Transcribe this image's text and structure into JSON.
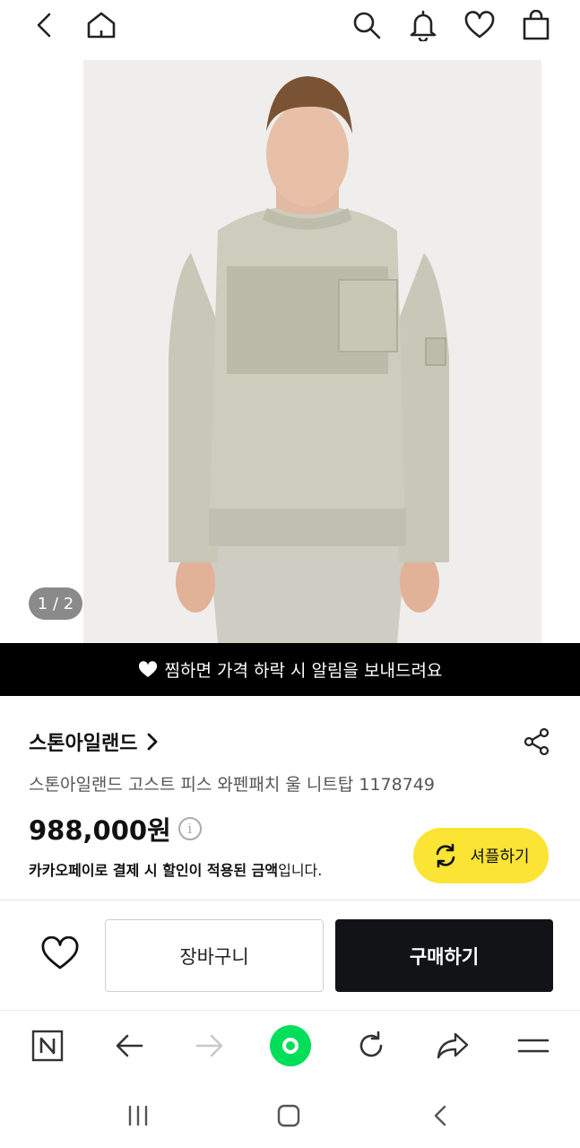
{
  "top_bar": {
    "icons": [
      "back-icon",
      "home-icon",
      "search-icon",
      "bell-icon",
      "heart-icon",
      "shopping-bag-icon"
    ]
  },
  "gallery": {
    "page_counter": "1 / 2"
  },
  "alert_banner": {
    "text": "찜하면 가격 하락 시 알림을 보내드려요"
  },
  "product": {
    "brand": "스톤아일랜드",
    "title": "스톤아일랜드 고스트 피스 와펜패치 울 니트탑 1178749",
    "price": "988,000원",
    "kakao_note_bold": "카카오페이로 결제 시 할인이 적용된 금액",
    "kakao_note_rest": "입니다."
  },
  "shuffle_button": {
    "label": "셔플하기"
  },
  "actions": {
    "cart_label": "장바구니",
    "buy_label": "구매하기"
  },
  "colors": {
    "banner_bg": "#000000",
    "shuffle_bg": "#fce434",
    "buy_bg": "#111316",
    "accent_green": "#00de5a"
  }
}
